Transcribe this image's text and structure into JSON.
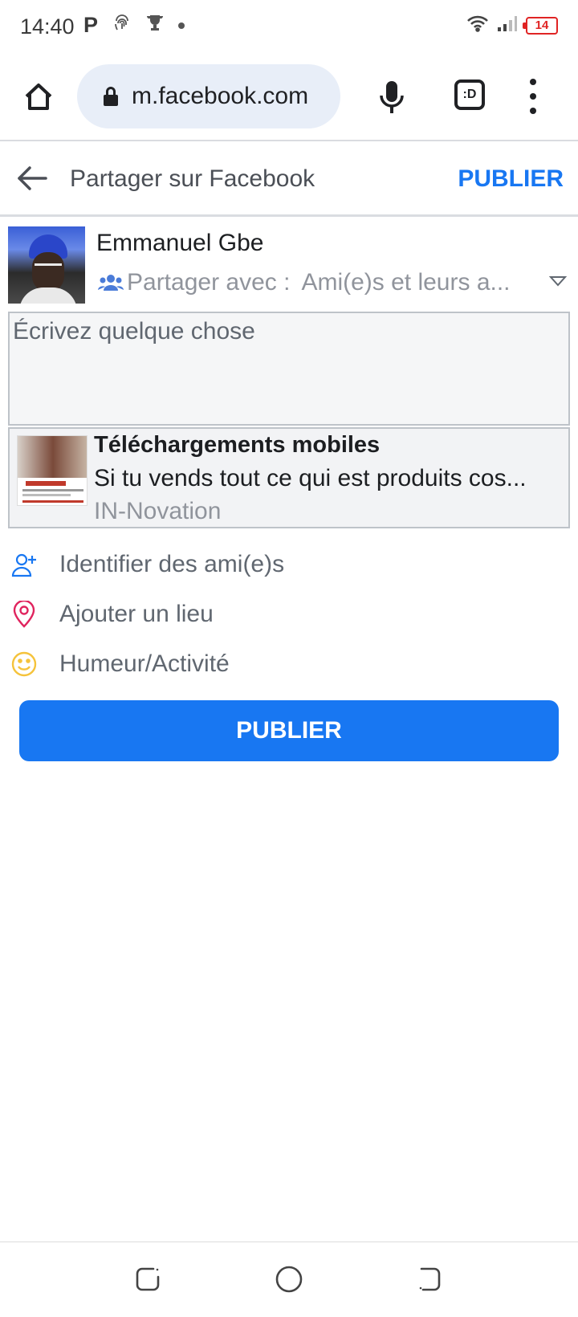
{
  "status_bar": {
    "time": "14:40",
    "left_icons": [
      "p-icon",
      "fingerprint-icon",
      "trophy-icon",
      "dot-icon"
    ],
    "right_icons": [
      "wifi-icon",
      "signal-icon",
      "battery-icon"
    ],
    "battery_level": "14",
    "battery_color": "#e02424"
  },
  "browser": {
    "url": "m.facebook.com",
    "tab_label": ":D"
  },
  "header": {
    "title": "Partager sur Facebook",
    "publish_label": "PUBLIER"
  },
  "profile": {
    "name": "Emmanuel Gbe",
    "share_label": "Partager avec :",
    "share_value": "Ami(e)s et leurs a..."
  },
  "compose": {
    "placeholder": "Écrivez quelque chose"
  },
  "link_card": {
    "title": "Téléchargements mobiles",
    "description": "Si tu vends tout ce qui est produits cos...",
    "source": "IN-Novation"
  },
  "actions": [
    {
      "label": "Identifier des ami(e)s",
      "icon": "add-friend-icon",
      "color": "#1877f2"
    },
    {
      "label": "Ajouter un lieu",
      "icon": "location-pin-icon",
      "color": "#e0245e"
    },
    {
      "label": "Humeur/Activité",
      "icon": "smiley-icon",
      "color": "#f5c33b"
    }
  ],
  "publish_button": {
    "label": "PUBLIER",
    "color": "#1877f2"
  },
  "colors": {
    "accent": "#1877f2",
    "muted_text": "#90949c"
  }
}
